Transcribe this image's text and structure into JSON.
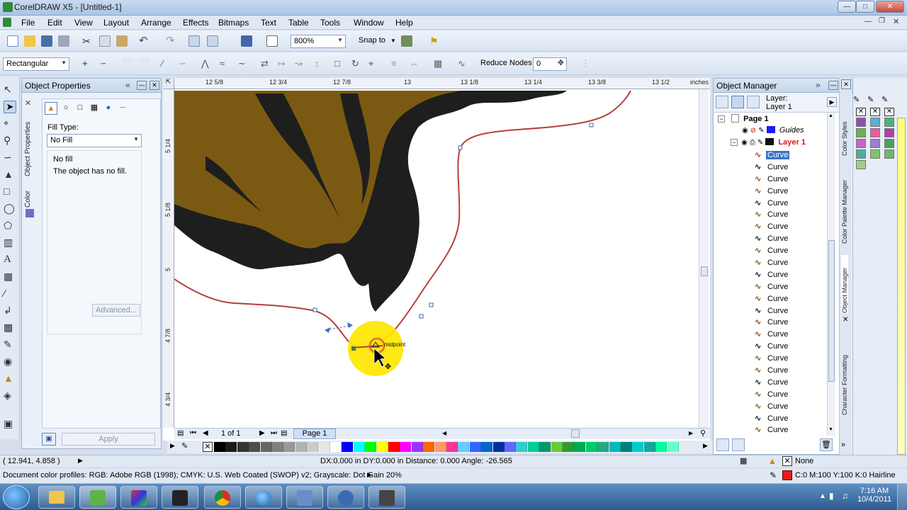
{
  "window": {
    "title": "CorelDRAW X5 - [Untitled-1]"
  },
  "menu": [
    "File",
    "Edit",
    "View",
    "Layout",
    "Arrange",
    "Effects",
    "Bitmaps",
    "Text",
    "Table",
    "Tools",
    "Window",
    "Help"
  ],
  "standard_toolbar": {
    "zoom": "800%",
    "snap_to": "Snap to"
  },
  "property_bar": {
    "mode": "Rectangular",
    "reduce_nodes_label": "Reduce Nodes",
    "reduce_nodes_value": "0"
  },
  "object_properties": {
    "title": "Object Properties",
    "fill_type_label": "Fill Type:",
    "fill_type_value": "No Fill",
    "no_fill": "No fill",
    "description": "The object has no fill.",
    "advanced": "Advanced...",
    "apply": "Apply",
    "side_tabs": [
      "Object Properties",
      "Color"
    ]
  },
  "ruler": {
    "units": "inches",
    "h_labels": [
      "12 5/8",
      "12 3/4",
      "12 7/8",
      "13",
      "13 1/8",
      "13 1/4",
      "13 3/8",
      "13 1/2"
    ],
    "v_labels": [
      "5 1/4",
      "5 1/8",
      "5",
      "4 7/8",
      "4 3/4"
    ]
  },
  "canvas": {
    "node_label": "midpoint"
  },
  "page_nav": {
    "count": "1 of 1",
    "tab": "Page 1"
  },
  "object_manager": {
    "title": "Object Manager",
    "layer_label": "Layer:",
    "layer_name": "Layer 1",
    "page": "Page 1",
    "guides": "Guides",
    "layer": "Layer 1",
    "items": [
      "Curve",
      "Curve",
      "Curve",
      "Curve",
      "Curve",
      "Curve",
      "Curve",
      "Curve",
      "Curve",
      "Curve",
      "Curve",
      "Curve",
      "Curve",
      "Curve",
      "Curve",
      "Curve",
      "Curve",
      "Curve",
      "Curve",
      "Curve",
      "Curve",
      "Curve",
      "Curve",
      "Curve"
    ]
  },
  "right_tabs": [
    "Color Styles",
    "Color Palette Manager",
    "Object Manager",
    "Character Formatting"
  ],
  "status": {
    "coords": "( 12.941, 4.858 )",
    "delta": "DX:0.000 in DY:0.000 in Distance: 0.000 Angle: -26.565",
    "fill": "None",
    "profiles": "Document color profiles: RGB: Adobe RGB (1998); CMYK: U.S. Web Coated (SWOP) v2; Grayscale: Dot Gain 20%",
    "outline": "C:0 M:100 Y:100 K:0  Hairline"
  },
  "clock": {
    "time": "7:16 AM",
    "date": "10/4/2011"
  },
  "colors": {
    "accent": "#3b73c4",
    "curve": "#b5403a",
    "hair_brown": "#7a5a12",
    "hair_black": "#1e1e1e",
    "highlight": "#ffe600"
  },
  "palette_swatches": [
    "#000000",
    "#1a1a1a",
    "#333333",
    "#4d4d4d",
    "#666666",
    "#808080",
    "#999999",
    "#b3b3b3",
    "#cccccc",
    "#e6e6e6",
    "#ffffff",
    "#0000ff",
    "#00ffff",
    "#00ff00",
    "#ffff00",
    "#ff0000",
    "#ff00ff",
    "#9933ff",
    "#ff6600",
    "#ff9966",
    "#ff3399",
    "#66ccff",
    "#3366ff",
    "#0066cc",
    "#003399",
    "#6666ff",
    "#33cccc",
    "#00cc99",
    "#009966",
    "#66cc33",
    "#339933",
    "#00aa55",
    "#00cc66",
    "#22aa88",
    "#00bbbb",
    "#008080",
    "#00cccc",
    "#11aa99",
    "#00ff99",
    "#66ffcc"
  ],
  "right_palette": [
    "#8e4fb0",
    "#5fb0d0",
    "#4db377",
    "#6bb34a",
    "#e85da0",
    "#b13eaa",
    "#c765c9",
    "#9b7fd2",
    "#49a25c",
    "#4db0a0",
    "#7dc36b",
    "#6cb86b",
    "#9fd080"
  ],
  "taskbar_apps": [
    "start",
    "explorer",
    "coreldraw-green",
    "photo-editor",
    "media",
    "chrome",
    "globe",
    "network",
    "sync",
    "device"
  ]
}
